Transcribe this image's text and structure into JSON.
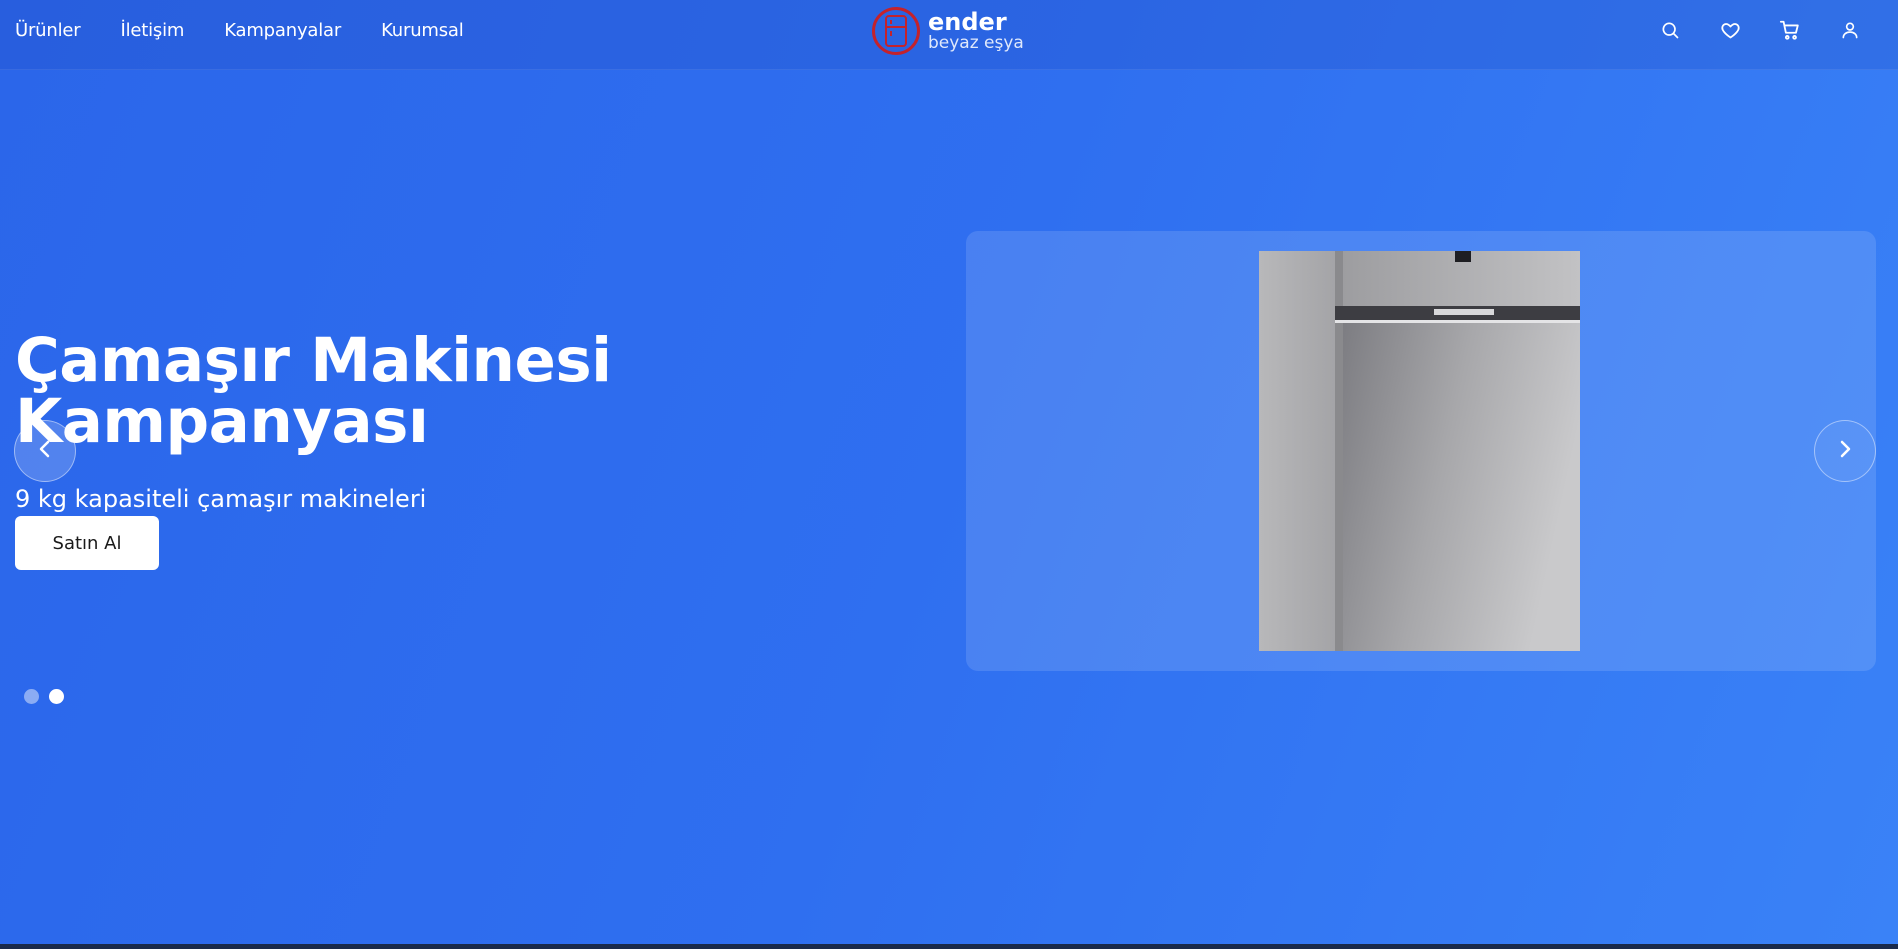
{
  "nav": {
    "items": [
      {
        "label": "Ürünler"
      },
      {
        "label": "İletişim"
      },
      {
        "label": "Kampanyalar"
      },
      {
        "label": "Kurumsal"
      }
    ]
  },
  "brand": {
    "name": "ender",
    "tagline": "beyaz eşya",
    "accent_color": "#c4222c"
  },
  "header_actions": [
    {
      "icon": "search-icon"
    },
    {
      "icon": "heart-icon"
    },
    {
      "icon": "cart-icon"
    },
    {
      "icon": "user-icon"
    }
  ],
  "hero": {
    "title": "Çamaşır Makinesi Kampanyası",
    "subtitle": "9 kg kapasiteli çamaşır makineleri",
    "cta_label": "Satın Al",
    "background_color": "#2f6ff0"
  },
  "carousel": {
    "prev_icon": "chevron-left-icon",
    "next_icon": "chevron-right-icon",
    "slide_count": 2,
    "active_slide": 2,
    "product_image": "refrigerator-image"
  }
}
